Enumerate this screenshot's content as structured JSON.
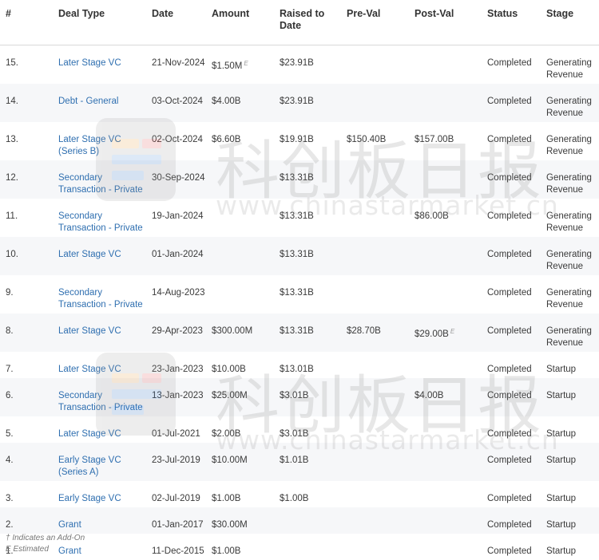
{
  "columns": [
    "#",
    "Deal Type",
    "Date",
    "Amount",
    "Raised to Date",
    "Pre-Val",
    "Post-Val",
    "Status",
    "Stage"
  ],
  "rows": [
    {
      "num": "15.",
      "deal_type": "Later Stage VC",
      "date": "21-Nov-2024",
      "amount": "$1.50M",
      "amount_est": "E",
      "raised": "$23.91B",
      "pre_val": "",
      "post_val": "",
      "post_est": "",
      "status": "Completed",
      "stage": "Generating Revenue"
    },
    {
      "num": "14.",
      "deal_type": "Debt - General",
      "date": "03-Oct-2024",
      "amount": "$4.00B",
      "amount_est": "",
      "raised": "$23.91B",
      "pre_val": "",
      "post_val": "",
      "post_est": "",
      "status": "Completed",
      "stage": "Generating Revenue"
    },
    {
      "num": "13.",
      "deal_type": "Later Stage VC (Series B)",
      "date": "02-Oct-2024",
      "amount": "$6.60B",
      "amount_est": "",
      "raised": "$19.91B",
      "pre_val": "$150.40B",
      "post_val": "$157.00B",
      "post_est": "",
      "status": "Completed",
      "stage": "Generating Revenue"
    },
    {
      "num": "12.",
      "deal_type": "Secondary Transaction - Private",
      "date": "30-Sep-2024",
      "amount": "",
      "amount_est": "",
      "raised": "$13.31B",
      "pre_val": "",
      "post_val": "",
      "post_est": "",
      "status": "Completed",
      "stage": "Generating Revenue"
    },
    {
      "num": "11.",
      "deal_type": "Secondary Transaction - Private",
      "date": "19-Jan-2024",
      "amount": "",
      "amount_est": "",
      "raised": "$13.31B",
      "pre_val": "",
      "post_val": "$86.00B",
      "post_est": "",
      "status": "Completed",
      "stage": "Generating Revenue"
    },
    {
      "num": "10.",
      "deal_type": "Later Stage VC",
      "date": "01-Jan-2024",
      "amount": "",
      "amount_est": "",
      "raised": "$13.31B",
      "pre_val": "",
      "post_val": "",
      "post_est": "",
      "status": "Completed",
      "stage": "Generating Revenue"
    },
    {
      "num": "9.",
      "deal_type": "Secondary Transaction - Private",
      "date": "14-Aug-2023",
      "amount": "",
      "amount_est": "",
      "raised": "$13.31B",
      "pre_val": "",
      "post_val": "",
      "post_est": "",
      "status": "Completed",
      "stage": "Generating Revenue"
    },
    {
      "num": "8.",
      "deal_type": "Later Stage VC",
      "date": "29-Apr-2023",
      "amount": "$300.00M",
      "amount_est": "",
      "raised": "$13.31B",
      "pre_val": "$28.70B",
      "post_val": "$29.00B",
      "post_est": "E",
      "status": "Completed",
      "stage": "Generating Revenue"
    },
    {
      "num": "7.",
      "deal_type": "Later Stage VC",
      "date": "23-Jan-2023",
      "amount": "$10.00B",
      "amount_est": "",
      "raised": "$13.01B",
      "pre_val": "",
      "post_val": "",
      "post_est": "",
      "status": "Completed",
      "stage": "Startup"
    },
    {
      "num": "6.",
      "deal_type": "Secondary Transaction - Private",
      "date": "13-Jan-2023",
      "amount": "$25.00M",
      "amount_est": "",
      "raised": "$3.01B",
      "pre_val": "",
      "post_val": "$4.00B",
      "post_est": "",
      "status": "Completed",
      "stage": "Startup"
    },
    {
      "num": "5.",
      "deal_type": "Later Stage VC",
      "date": "01-Jul-2021",
      "amount": "$2.00B",
      "amount_est": "",
      "raised": "$3.01B",
      "pre_val": "",
      "post_val": "",
      "post_est": "",
      "status": "Completed",
      "stage": "Startup"
    },
    {
      "num": "4.",
      "deal_type": "Early Stage VC (Series A)",
      "date": "23-Jul-2019",
      "amount": "$10.00M",
      "amount_est": "",
      "raised": "$1.01B",
      "pre_val": "",
      "post_val": "",
      "post_est": "",
      "status": "Completed",
      "stage": "Startup"
    },
    {
      "num": "3.",
      "deal_type": "Early Stage VC",
      "date": "02-Jul-2019",
      "amount": "$1.00B",
      "amount_est": "",
      "raised": "$1.00B",
      "pre_val": "",
      "post_val": "",
      "post_est": "",
      "status": "Completed",
      "stage": "Startup"
    },
    {
      "num": "2.",
      "deal_type": "Grant",
      "date": "01-Jan-2017",
      "amount": "$30.00M",
      "amount_est": "",
      "raised": "",
      "pre_val": "",
      "post_val": "",
      "post_est": "",
      "status": "Completed",
      "stage": "Startup"
    },
    {
      "num": "1.",
      "deal_type": "Grant",
      "date": "11-Dec-2015",
      "amount": "$1.00B",
      "amount_est": "",
      "raised": "",
      "pre_val": "",
      "post_val": "",
      "post_est": "",
      "status": "Completed",
      "stage": "Startup"
    }
  ],
  "footnotes": [
    "† Indicates an Add-On",
    "E Estimated"
  ],
  "watermark": {
    "brand_cn": "科创板日报",
    "url": "www.chinastarmarket.cn"
  }
}
